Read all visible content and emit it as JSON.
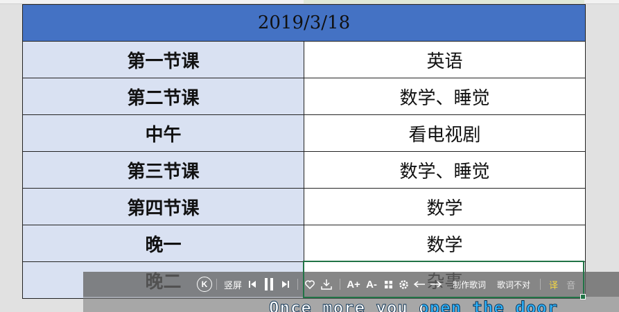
{
  "schedule": {
    "title": "2019/3/18",
    "rows": [
      {
        "label": "第一节课",
        "value": "英语"
      },
      {
        "label": "第二节课",
        "value": "数学、睡觉"
      },
      {
        "label": "中午",
        "value": "看电视剧"
      },
      {
        "label": "第三节课",
        "value": "数学、睡觉"
      },
      {
        "label": "第四节课",
        "value": "数学"
      },
      {
        "label": "晚一",
        "value": "数学"
      },
      {
        "label": "晚二",
        "value": "杂事"
      }
    ]
  },
  "lyrics_toolbar": {
    "k_icon": "K",
    "vertical_screen": "竖屏",
    "make_lyrics": "制作歌词",
    "wrong_lyrics": "歌词不对",
    "translate": "译",
    "phonetic": "音",
    "font_up": "A+",
    "font_down": "A-",
    "icons": [
      "k-song-icon",
      "previous-icon",
      "pause-icon",
      "next-icon",
      "like-icon",
      "download-icon",
      "grid-icon",
      "settings-icon",
      "back-icon",
      "forward-icon"
    ]
  },
  "lyric_text": "Once more you open the door",
  "colors": {
    "title_bg": "#4472c4",
    "label_bg": "#d9e1f2",
    "selection": "#217346",
    "lyric_sung": "#31b6ff"
  }
}
